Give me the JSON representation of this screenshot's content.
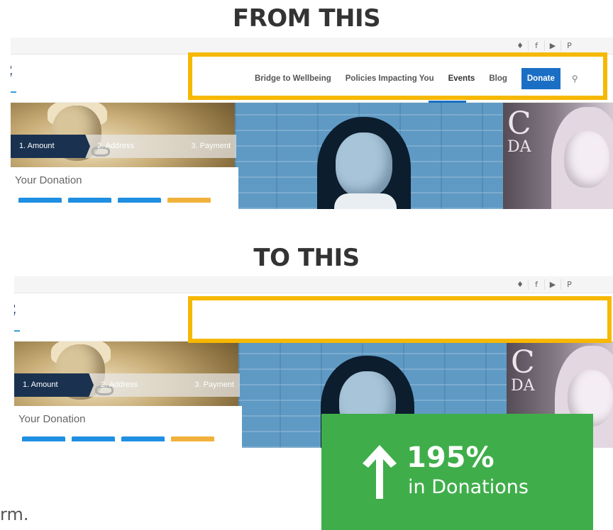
{
  "headings": {
    "before": "FROM THIS",
    "after": "TO THIS"
  },
  "socials": [
    {
      "icon": "twitter-icon",
      "glyph": "♦"
    },
    {
      "icon": "facebook-icon",
      "glyph": "f"
    },
    {
      "icon": "youtube-icon",
      "glyph": "▶"
    },
    {
      "icon": "pinterest-icon",
      "glyph": "P"
    }
  ],
  "nav": {
    "items": [
      "Bridge to Wellbeing",
      "Policies Impacting You",
      "Events",
      "Blog"
    ],
    "donate": "Donate",
    "search_icon": "search-icon",
    "search_glyph": "⚲"
  },
  "steps": [
    "1. Amount",
    "2. Address",
    "3. Payment"
  ],
  "form": {
    "title": "Your Donation"
  },
  "stat": {
    "value": "195%",
    "label": "in Donations",
    "icon": "arrow-up-icon"
  },
  "caption_fragment": "rm.",
  "colors": {
    "highlight": "#f6b800",
    "donate": "#1a6fc4",
    "stat_bg": "#3fae4a",
    "step_active": "#1a3250"
  }
}
